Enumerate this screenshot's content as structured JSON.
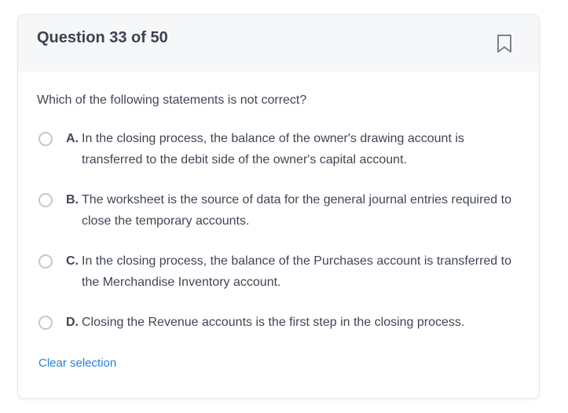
{
  "header": {
    "question_label": "Question 33 of 50"
  },
  "question": {
    "text": "Which of the following statements is not correct?"
  },
  "options": [
    {
      "letter": "A.",
      "text": "In the closing process, the balance of the owner's drawing account is transferred to the debit side of the owner's capital account."
    },
    {
      "letter": "B.",
      "text": "The worksheet is the source of data for the general journal entries required to close the temporary accounts."
    },
    {
      "letter": "C.",
      "text": "In the closing process, the balance of the Purchases account is transferred to the Merchandise Inventory account."
    },
    {
      "letter": "D.",
      "text": "Closing the Revenue accounts is the first step in the closing process."
    }
  ],
  "footer": {
    "clear_label": "Clear selection"
  },
  "icons": {
    "bookmark": "bookmark-icon",
    "radio": "radio-unchecked-icon"
  },
  "colors": {
    "link": "#2c7fd6",
    "header_bg": "#f6f7f9",
    "border": "#e5e7eb"
  }
}
